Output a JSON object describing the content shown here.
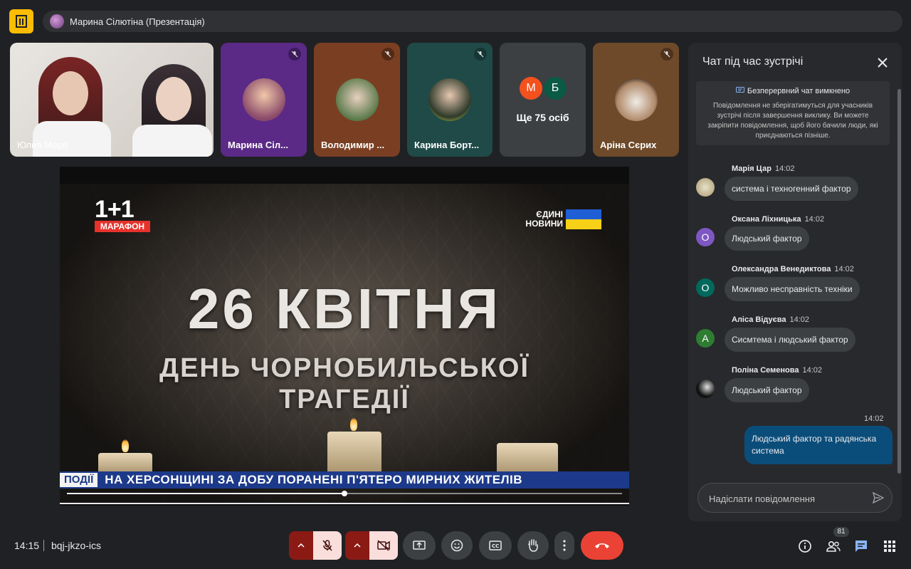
{
  "presenter": {
    "label": "Марина Сілютіна (Презентація)"
  },
  "tiles": [
    {
      "name": "Юлия Моря"
    },
    {
      "name": "Марина Сіл..."
    },
    {
      "name": "Володимир ..."
    },
    {
      "name": "Карина Борт..."
    },
    {
      "name": "Ще 75 осіб",
      "initials": [
        "М",
        "Б"
      ]
    },
    {
      "name": "Аріна Сєрих"
    }
  ],
  "video": {
    "channel_logo": "1+1",
    "channel_sub": "МАРАФОН",
    "news_logo": "ЄДИНІ НОВИНИ",
    "headline_1": "26 КВІТНЯ",
    "headline_2": "ДЕНЬ ЧОРНОБИЛЬСЬКОЇ",
    "headline_3": "ТРАГЕДІЇ",
    "ticker_tag": "ПОДІЇ",
    "ticker_text": "НА ХЕРСОНЩИНІ ЗА ДОБУ ПОРАНЕНІ П'ЯТЕРО МИРНИХ ЖИТЕЛІВ",
    "progress": 0.5
  },
  "chat": {
    "title": "Чат під час зустрічі",
    "notice_title": "Безперервний чат вимкнено",
    "notice_body": "Повідомлення не зберігатимуться для учасників зустрічі після завершення виклику. Ви можете закріпити повідомлення, щоб його бачили люди, які приєднаються пізніше.",
    "messages": [
      {
        "author": "Марія Цар",
        "time": "14:02",
        "text": "система і техногенний фактор",
        "avatar": ""
      },
      {
        "author": "Оксана Ліхницька",
        "time": "14:02",
        "text": "Людський фактор",
        "avatar": "О",
        "color": "#7e57c2"
      },
      {
        "author": "Олександра Венедиктова",
        "time": "14:02",
        "text": "Можливо несправність техніки",
        "avatar": "О",
        "color": "#00695c"
      },
      {
        "author": "Аліса Відуєва",
        "time": "14:02",
        "text": "Сисмтема і людський фактор",
        "avatar": "А",
        "color": "#2e7d32"
      },
      {
        "author": "Поліна Семенова",
        "time": "14:02",
        "text": "Людський фактор",
        "avatar": ""
      }
    ],
    "own_time": "14:02",
    "own_text": "Людський фактор та радянська система",
    "input_placeholder": "Надіслати повідомлення"
  },
  "footer": {
    "time": "14:15",
    "meeting_code": "bqj-jkzo-ics",
    "participants_count": "81"
  },
  "colors": {
    "end_call": "#ea4335",
    "mic_off": "#f9dedc",
    "accent": "#8ab4f8"
  }
}
